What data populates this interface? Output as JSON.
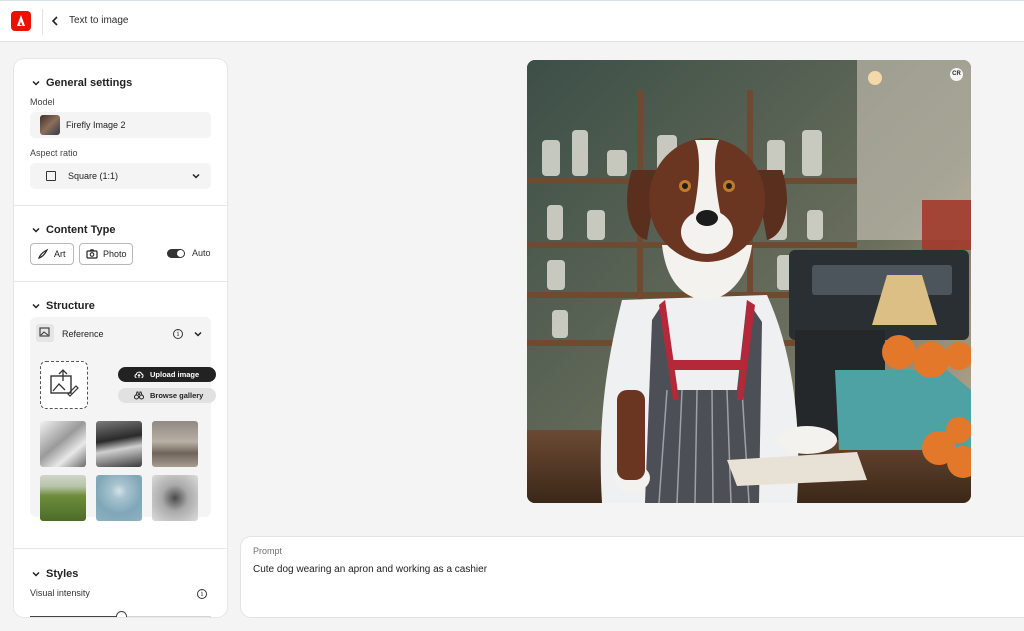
{
  "header": {
    "back_icon": "chevron-left-icon",
    "breadcrumb": "Text to image",
    "logo": "adobe-logo"
  },
  "general_settings": {
    "title": "General settings",
    "model_label": "Model",
    "model_value": "Firefly Image 2",
    "aspect_label": "Aspect ratio",
    "aspect_value": "Square (1:1)"
  },
  "content_type": {
    "title": "Content Type",
    "art_label": "Art",
    "photo_label": "Photo",
    "auto_label": "Auto",
    "auto_on": true
  },
  "structure": {
    "title": "Structure",
    "reference_label": "Reference",
    "upload_label": "Upload image",
    "browse_label": "Browse gallery"
  },
  "styles": {
    "title": "Styles",
    "visual_intensity_label": "Visual intensity",
    "visual_intensity": 0.5
  },
  "prompt": {
    "label": "Prompt",
    "text": "Cute dog wearing an apron and working as a cashier"
  },
  "image": {
    "badge": "CR"
  }
}
